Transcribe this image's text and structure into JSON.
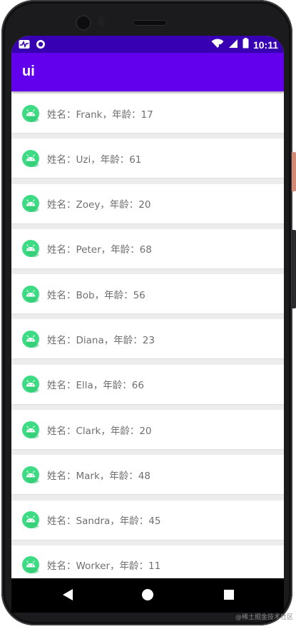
{
  "status_bar": {
    "time": "10:11",
    "icons": [
      "activity-icon",
      "notification-circle-icon",
      "wifi-icon",
      "signal-icon",
      "battery-icon"
    ]
  },
  "app_bar": {
    "title": "ui"
  },
  "list": {
    "items": [
      {
        "text": "姓名：Frank，年龄：17"
      },
      {
        "text": "姓名：Uzi，年龄：61"
      },
      {
        "text": "姓名：Zoey，年龄：20"
      },
      {
        "text": "姓名：Peter，年龄：68"
      },
      {
        "text": "姓名：Bob，年龄：56"
      },
      {
        "text": "姓名：Diana，年龄：23"
      },
      {
        "text": "姓名：Ella，年龄：66"
      },
      {
        "text": "姓名：Clark，年龄：20"
      },
      {
        "text": "姓名：Mark，年龄：48"
      },
      {
        "text": "姓名：Sandra，年龄：45"
      },
      {
        "text": "姓名：Worker，年龄：11"
      }
    ],
    "icon": "android-icon"
  },
  "nav_bar": {
    "icons": [
      "back-icon",
      "home-icon",
      "recents-icon"
    ]
  },
  "watermark": "@稀土掘金技术社区",
  "colors": {
    "status_bar": "#3700b3",
    "app_bar": "#6200ee",
    "android_icon": "#3ddc84",
    "list_text": "#6f6f6f",
    "list_background": "#ececec"
  }
}
